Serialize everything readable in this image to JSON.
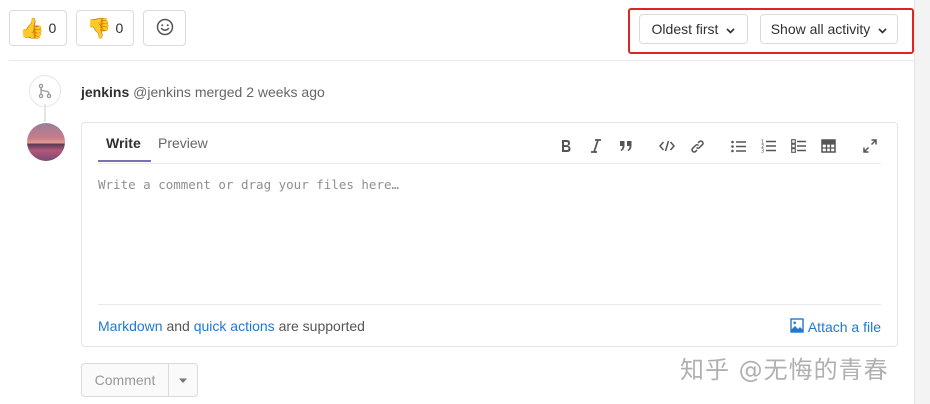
{
  "reactions": [
    {
      "icon": "thumbs-up-icon",
      "emoji": "👍",
      "count": "0"
    },
    {
      "icon": "thumbs-down-icon",
      "emoji": "👎",
      "count": "0"
    }
  ],
  "sort": {
    "order_label": "Oldest first",
    "filter_label": "Show all activity"
  },
  "activity": {
    "author": "jenkins",
    "handle": "@jenkins",
    "action": "merged",
    "time": "2 weeks ago"
  },
  "editor": {
    "tab_write": "Write",
    "tab_preview": "Preview",
    "placeholder": "Write a comment or drag your files here…",
    "footer": {
      "markdown": "Markdown",
      "and": "and",
      "quick_actions": "quick actions",
      "supported": "are supported"
    },
    "attach_label": "Attach a file"
  },
  "comment_button": "Comment",
  "watermark": "知乎 @无悔的青春",
  "colors": {
    "accent": "#1f78d1",
    "highlight": "#e02424",
    "tab_active": "#7e6fb5"
  }
}
